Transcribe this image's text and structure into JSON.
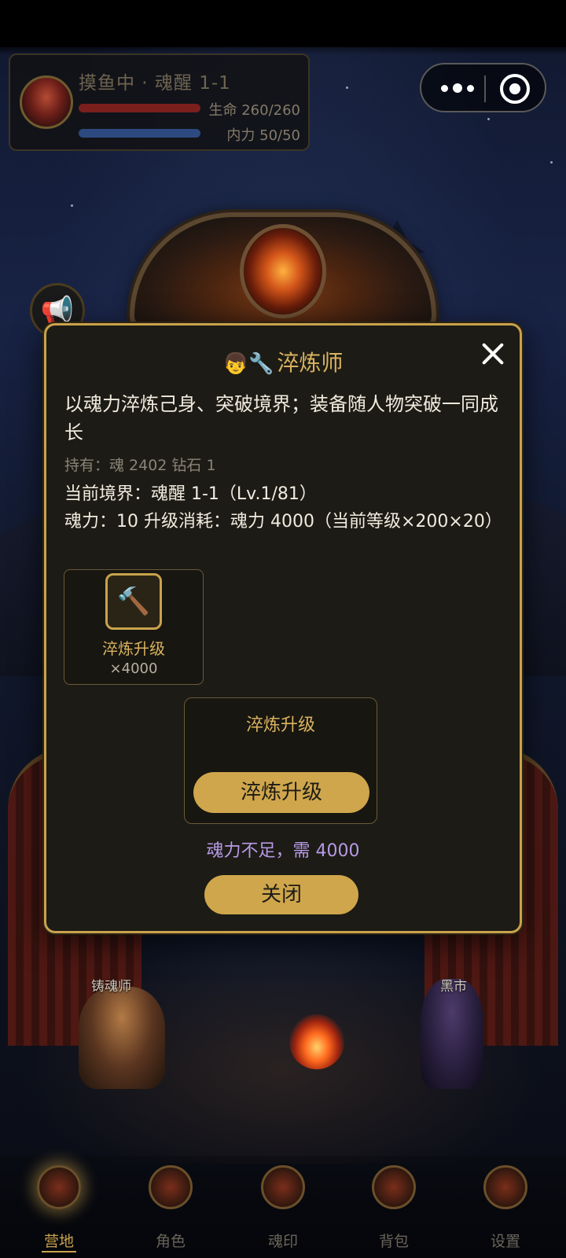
{
  "status": {
    "title": "摸鱼中 · 魂醒 1-1",
    "hp_text": "生命 260/260",
    "mp_text": "内力 50/50",
    "hp_fraction": 1.0,
    "mp_fraction": 1.0
  },
  "capsule": {
    "more_icon": "more-dots-icon",
    "close_icon": "target-icon"
  },
  "scene": {
    "npc_smith": "铸魂师",
    "npc_market": "黑市"
  },
  "modal": {
    "title_icons": "👦🔧",
    "title": "淬炼师",
    "description": "以魂力淬炼己身、突破境界；装备随人物突破一同成长",
    "holding": "持有：魂 2402  钻石 1",
    "realm": "当前境界：魂醒 1-1（Lv.1/81）",
    "cost": "魂力：10    升级消耗：魂力 4000（当前等级×200×20）",
    "item": {
      "icon": "🔨",
      "name": "淬炼升级",
      "qty": "×4000"
    },
    "action_box_title": "淬炼升级",
    "upgrade_button": "淬炼升级",
    "warning": "魂力不足，需 4000",
    "close_button": "关闭"
  },
  "nav": {
    "items": [
      {
        "label": "营地",
        "active": true
      },
      {
        "label": "角色",
        "active": false
      },
      {
        "label": "魂印",
        "active": false
      },
      {
        "label": "背包",
        "active": false
      },
      {
        "label": "设置",
        "active": false
      }
    ]
  },
  "colors": {
    "accent_gold": "#c9a24c",
    "warning_purple": "#b69ae6",
    "hp_red": "#7a1f1c",
    "mp_blue": "#2c4a80"
  }
}
